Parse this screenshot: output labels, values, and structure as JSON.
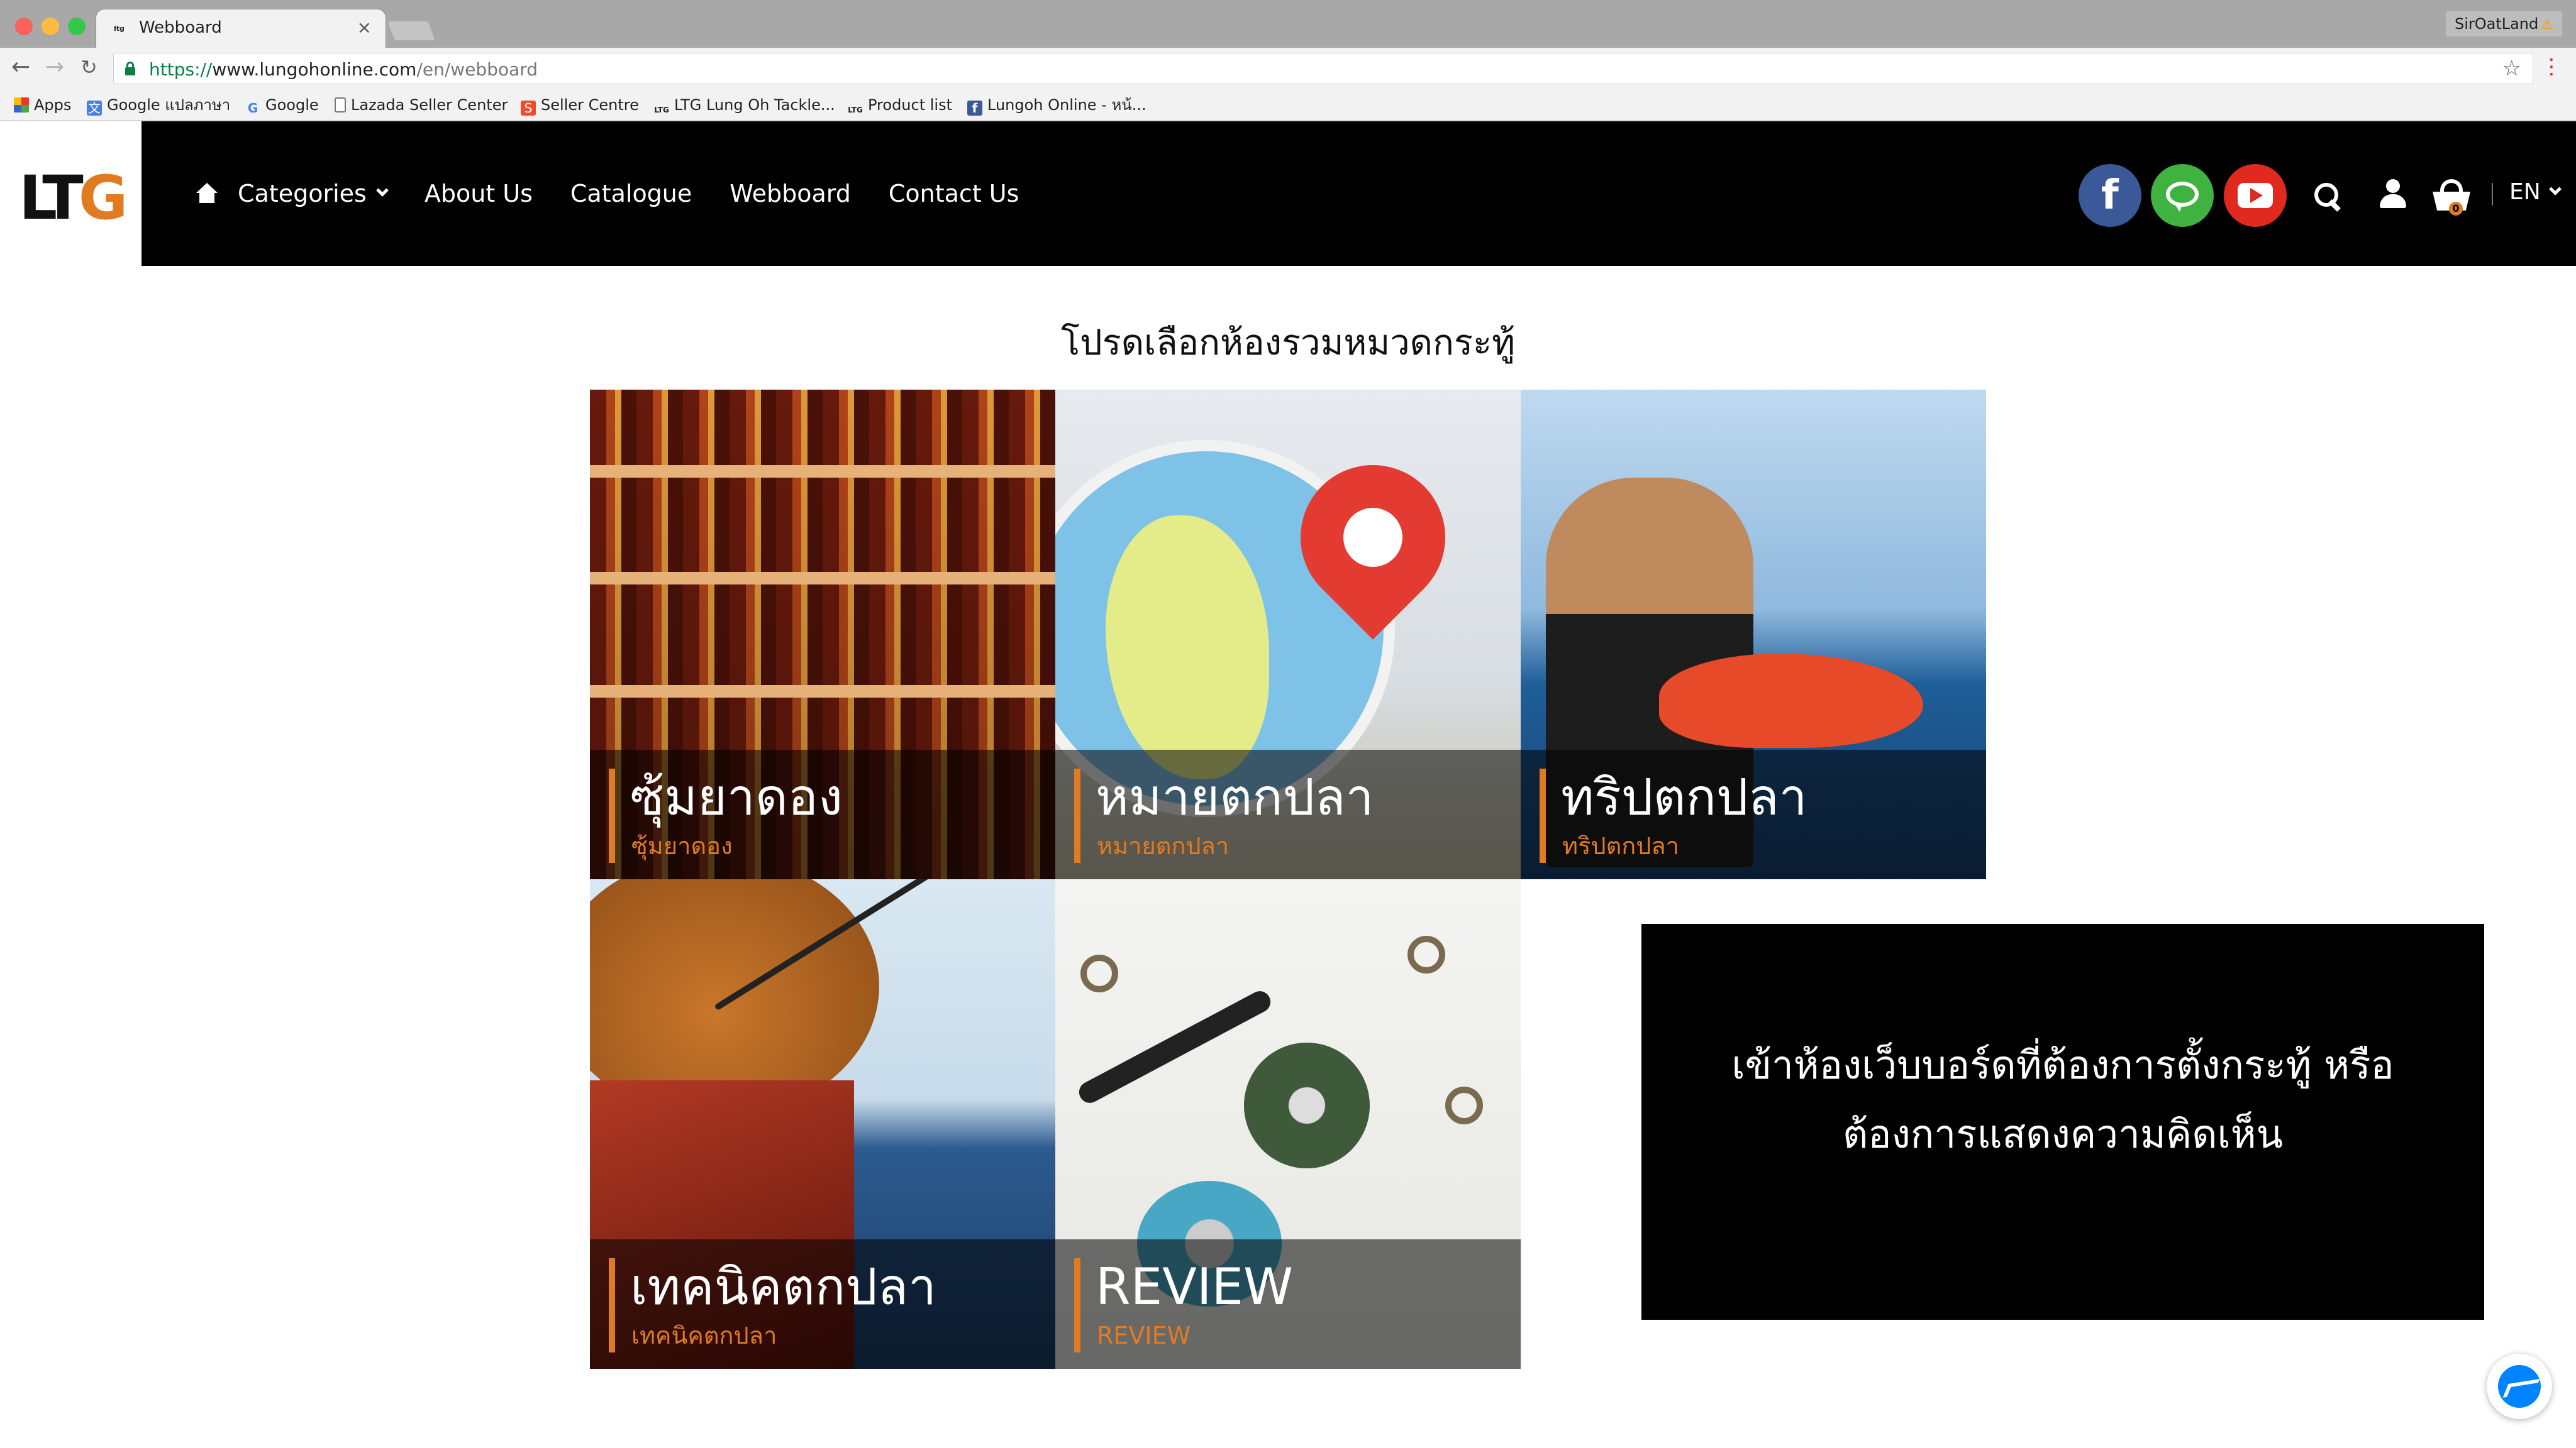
{
  "browser": {
    "tab_title": "Webboard",
    "tab_favicon": "ltg",
    "profile_name": "SirOatLand",
    "url_scheme": "https://",
    "url_host": "www.lungohonline.com",
    "url_path": "/en/webboard",
    "bookmarks": [
      {
        "label": "Apps",
        "icon": "apps-grid-icon"
      },
      {
        "label": "Google แปลภาษา",
        "icon": "google-translate-icon"
      },
      {
        "label": "Google",
        "icon": "google-icon"
      },
      {
        "label": "Lazada Seller Center",
        "icon": "page-icon"
      },
      {
        "label": "Seller Centre",
        "icon": "shopee-icon"
      },
      {
        "label": "LTG Lung Oh Tackle...",
        "icon": "ltg-icon"
      },
      {
        "label": "Product list",
        "icon": "ltg-icon"
      },
      {
        "label": "Lungoh Online - หน้...",
        "icon": "facebook-icon"
      }
    ]
  },
  "site": {
    "logo_lt": "LT",
    "logo_g": "G",
    "nav": {
      "categories": "Categories",
      "about": "About Us",
      "catalogue": "Catalogue",
      "webboard": "Webboard",
      "contact": "Contact Us"
    },
    "cart_count": "0",
    "language": "EN",
    "accent_color": "#e07b22"
  },
  "content": {
    "heading": "โปรดเลือกห้องรวมหมวดกระทู้",
    "boards": [
      {
        "title": "ซุ้มยาดอง",
        "subtitle": "ซุ้มยาดอง"
      },
      {
        "title": "หมายตกปลา",
        "subtitle": "หมายตกปลา"
      },
      {
        "title": "ทริปตกปลา",
        "subtitle": "ทริปตกปลา"
      },
      {
        "title": "เทคนิคตกปลา",
        "subtitle": "เทคนิคตกปลา"
      },
      {
        "title": "REVIEW",
        "subtitle": "REVIEW"
      }
    ],
    "promo_line1": "เข้าห้องเว็บบอร์ดที่ต้องการตั้งกระทู้ หรือ",
    "promo_line2": "ต้องการแสดงความคิดเห็น"
  }
}
